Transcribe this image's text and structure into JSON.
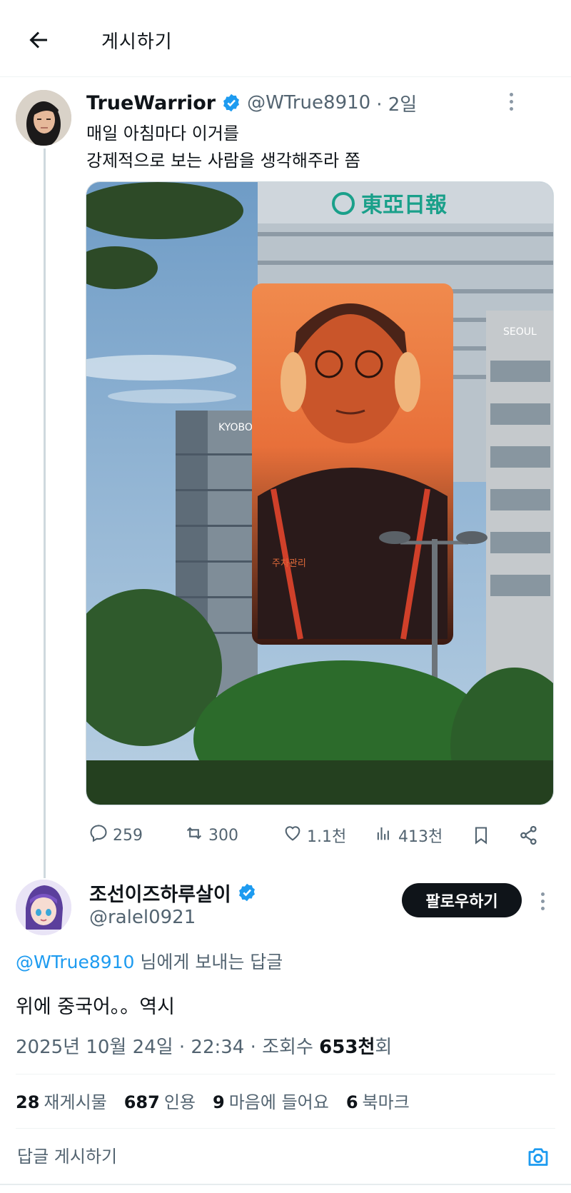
{
  "header": {
    "title": "게시하기"
  },
  "tweet": {
    "display_name": "TrueWarrior",
    "handle": "@WTrue8910",
    "time": "· 2일",
    "text_line1": "매일 아침마다 이거를",
    "text_line2": "강제적으로 보는 사람을 생각해주라 쫌",
    "image": {
      "sign_top": "東亞日報",
      "sign_kyobo": "KYOBO",
      "sign_seoul": "SEOUL",
      "screen_caption": "주차관리"
    },
    "actions": {
      "replies": "259",
      "reposts": "300",
      "likes": "1.1천",
      "views": "413천"
    }
  },
  "reply": {
    "display_name": "조선이즈하루살이",
    "handle": "@ralel0921",
    "follow_label": "팔로우하기",
    "mention": "@WTrue8910",
    "mention_suffix": " 님에게 보내는 답글",
    "text": "위에 중국어。。역시",
    "meta_date": "2025년 10월 24일 · 22:34 · 조회수 ",
    "meta_views": "653천",
    "meta_views_suffix": "회",
    "stats": [
      {
        "num": "28",
        "label": "재게시물"
      },
      {
        "num": "687",
        "label": "인용"
      },
      {
        "num": "9",
        "label": "마음에 들어요"
      },
      {
        "num": "6",
        "label": "북마크"
      }
    ]
  },
  "composer": {
    "placeholder": "답글 게시하기"
  },
  "colors": {
    "accent": "#1d9bf0",
    "text": "#0f1419",
    "secondary": "#536471",
    "follow_bg": "#0f1419"
  },
  "icons": [
    "back-arrow-icon",
    "verified-badge-icon",
    "more-icon",
    "reply-icon",
    "repost-icon",
    "like-icon",
    "views-icon",
    "bookmark-icon",
    "share-icon",
    "camera-icon"
  ]
}
